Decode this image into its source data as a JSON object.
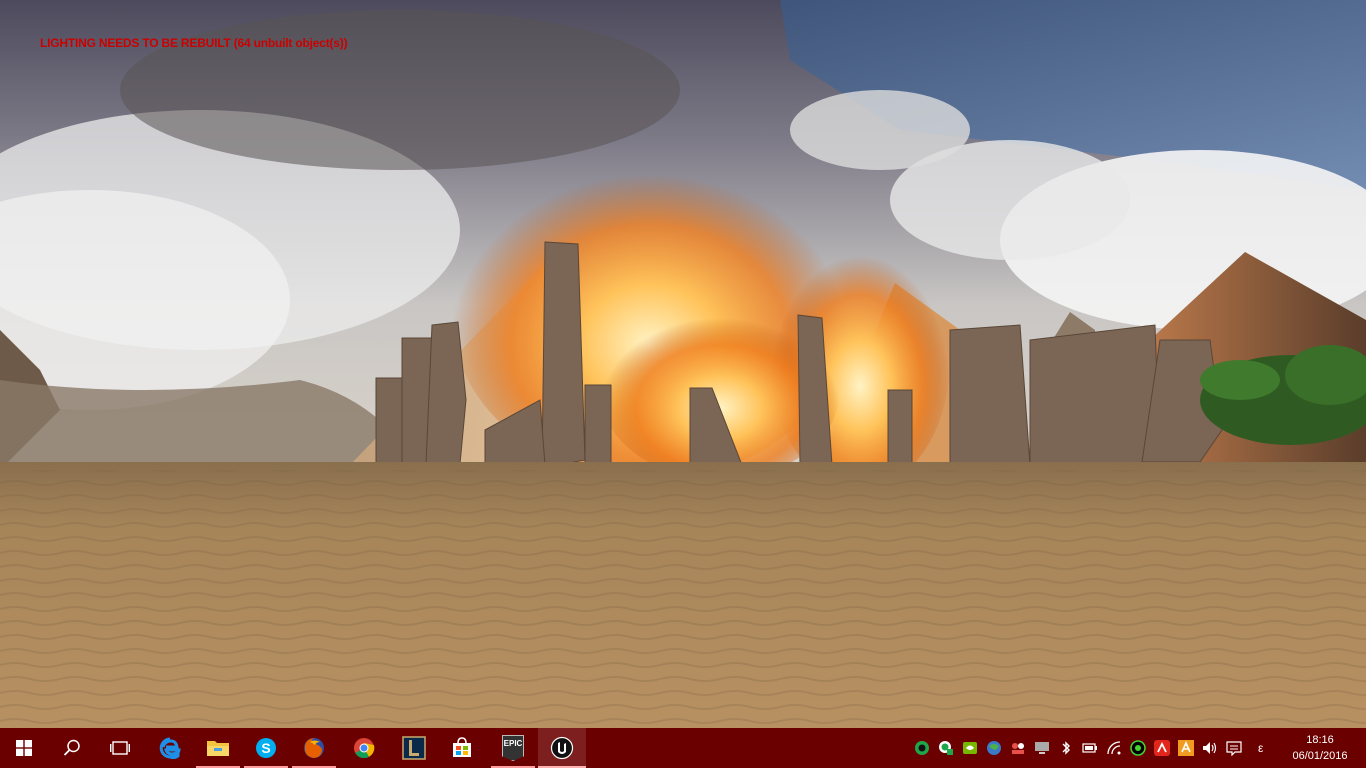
{
  "game": {
    "warning_text": "LIGHTING NEEDS TO BE REBUILT (64 unbuilt object(s))",
    "warning_color": "#cc0000",
    "scene_description_elements": [
      "cloudy-sky",
      "pyramid-left",
      "pyramid-right",
      "ruined-stone-pillars",
      "fire",
      "sand-desert",
      "palm-plants",
      "rock-hills"
    ]
  },
  "taskbar": {
    "background": "#6b0000",
    "start_icon": "windows-logo-icon",
    "search_icon": "search-icon",
    "task_view_icon": "task-view-icon",
    "apps": [
      {
        "name": "edge",
        "icon": "edge-icon",
        "running": false,
        "active": false
      },
      {
        "name": "file-explorer",
        "icon": "folder-icon",
        "running": true,
        "active": false
      },
      {
        "name": "skype",
        "icon": "skype-icon",
        "running": true,
        "active": false
      },
      {
        "name": "firefox",
        "icon": "firefox-icon",
        "running": true,
        "active": false
      },
      {
        "name": "chrome",
        "icon": "chrome-icon",
        "running": false,
        "active": false
      },
      {
        "name": "league-of-legends",
        "icon": "lol-icon",
        "running": false,
        "active": false
      },
      {
        "name": "store",
        "icon": "store-icon",
        "running": false,
        "active": false
      },
      {
        "name": "epic-games",
        "icon": "epic-games-icon",
        "label": "EPIC",
        "running": true,
        "active": false
      },
      {
        "name": "unreal-engine",
        "icon": "unreal-engine-icon",
        "running": true,
        "active": true
      }
    ],
    "tray_icons": [
      "circle-icon",
      "green-app-icon",
      "nvidia-icon",
      "network-globe-icon",
      "people-icon",
      "monitor-icon",
      "bluetooth-icon",
      "battery-icon",
      "wifi-icon",
      "razer-icon",
      "avira-icon",
      "avast-icon",
      "volume-icon",
      "action-center-icon"
    ],
    "language": "ε",
    "time": "18:16",
    "date": "06/01/2016"
  }
}
